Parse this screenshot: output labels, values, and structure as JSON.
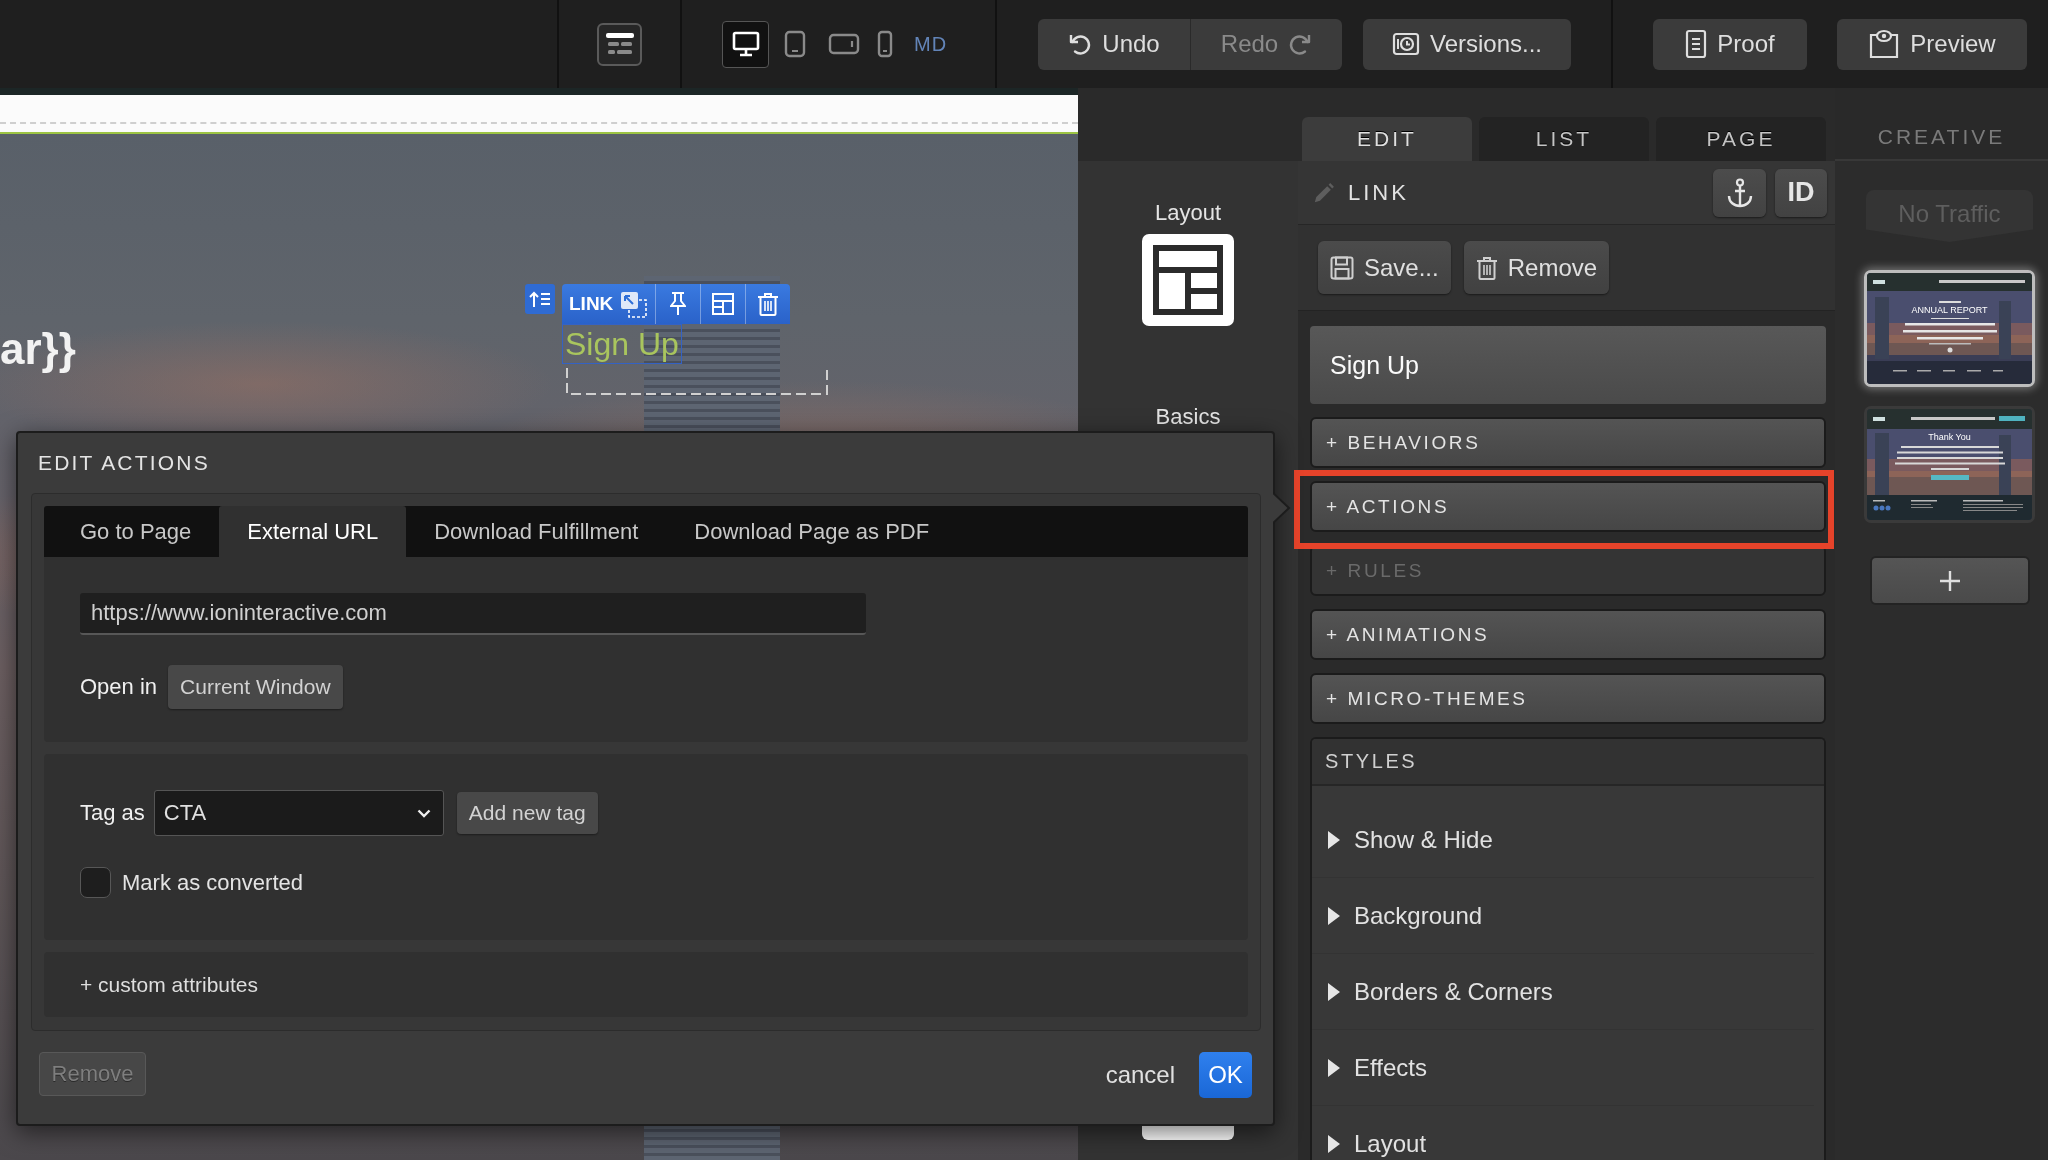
{
  "toolbar": {
    "view_modes": [
      {
        "kind": "desktop",
        "selected": true
      },
      {
        "kind": "tablet",
        "selected": false
      },
      {
        "kind": "tablet_landscape",
        "selected": false
      },
      {
        "kind": "phone",
        "selected": false
      }
    ],
    "breakpoint": "MD",
    "history": [
      {
        "kind": "undo",
        "label": "Undo",
        "disabled": false
      },
      {
        "kind": "redo",
        "label": "Redo",
        "disabled": true
      }
    ],
    "actions": [
      {
        "kind": "versions",
        "label": "Versions..."
      },
      {
        "kind": "proof",
        "label": "Proof"
      },
      {
        "kind": "preview",
        "label": "Preview"
      }
    ]
  },
  "canvas": {
    "heading_fragment": "ar}}",
    "selected_element": {
      "type": "LINK",
      "text": "Sign Up"
    }
  },
  "palette": {
    "groups": [
      {
        "kind": "layout",
        "label": "Layout"
      },
      {
        "kind": "basics",
        "label": "Basics"
      }
    ]
  },
  "edit_actions_dialog": {
    "title": "EDIT ACTIONS",
    "tabs": [
      {
        "label": "Go to Page",
        "selected": false
      },
      {
        "label": "External URL",
        "selected": true
      },
      {
        "label": "Download Fulfillment",
        "selected": false
      },
      {
        "label": "Download Page as PDF",
        "selected": false
      }
    ],
    "url": "https://www.ioninteractive.com",
    "open_in": {
      "label": "Open in",
      "value": "Current Window"
    },
    "tag": {
      "label": "Tag as",
      "value": "CTA",
      "add_button": "Add new tag"
    },
    "mark_as_converted": {
      "label": "Mark as converted",
      "checked": false
    },
    "custom_attributes": "+ custom attributes",
    "remove_button": {
      "label": "Remove",
      "disabled": true
    },
    "cancel": "cancel",
    "ok": "OK"
  },
  "inspector": {
    "tabs": [
      {
        "label": "EDIT",
        "selected": true
      },
      {
        "label": "LIST",
        "selected": false
      },
      {
        "label": "PAGE",
        "selected": false
      }
    ],
    "element_type": "LINK",
    "id_button": "ID",
    "save_button": "Save...",
    "remove_button": "Remove",
    "element_text": "Sign Up",
    "sections": [
      {
        "label": "+ BEHAVIORS",
        "disabled": false,
        "highlighted": false
      },
      {
        "label": "+ ACTIONS",
        "disabled": false,
        "highlighted": true
      },
      {
        "label": "+ RULES",
        "disabled": true,
        "highlighted": false
      },
      {
        "label": "+ ANIMATIONS",
        "disabled": false,
        "highlighted": false
      },
      {
        "label": "+ MICRO-THEMES",
        "disabled": false,
        "highlighted": false
      }
    ],
    "styles": {
      "title": "STYLES",
      "items": [
        {
          "label": "Show & Hide",
          "expanded": false
        },
        {
          "label": "Background",
          "expanded": false
        },
        {
          "label": "Borders & Corners",
          "expanded": false
        },
        {
          "label": "Effects",
          "expanded": false
        },
        {
          "label": "Layout",
          "expanded": false
        }
      ]
    }
  },
  "creative": {
    "title": "CREATIVE",
    "traffic": "No Traffic",
    "pages": [
      {
        "kind": "report",
        "selected": true,
        "title": "ANNUAL REPORT"
      },
      {
        "kind": "thank_you",
        "selected": false,
        "title": "Thank You"
      }
    ]
  }
}
